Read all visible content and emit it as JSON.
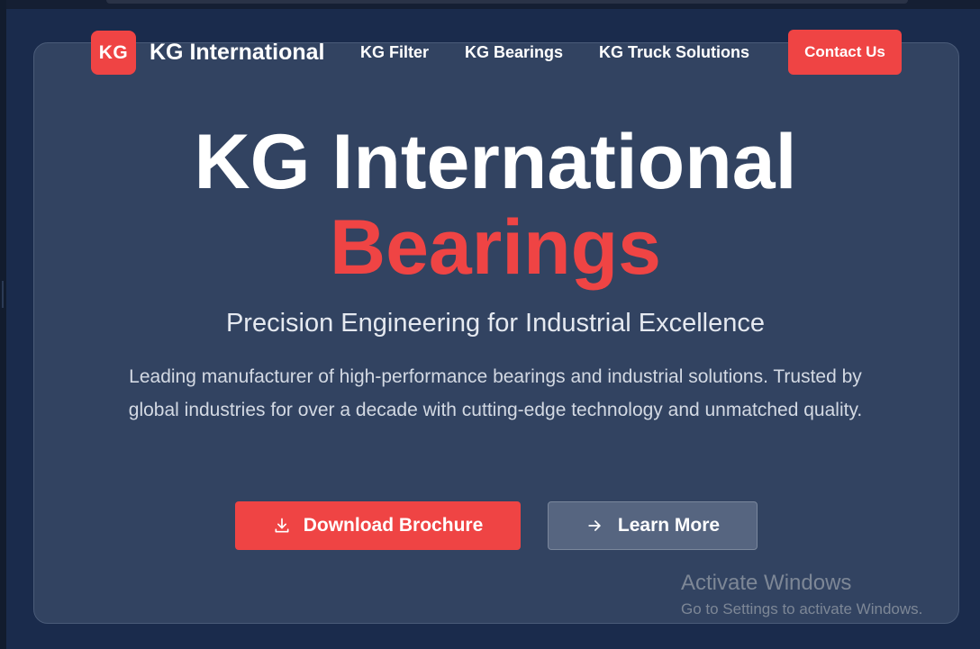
{
  "nav": {
    "logo_badge": "KG",
    "logo_text": "KG International",
    "links": [
      "KG Filter",
      "KG Bearings",
      "KG Truck Solutions"
    ],
    "contact_label": "Contact Us"
  },
  "hero": {
    "title_line1": "KG International",
    "title_line2": "Bearings",
    "subtitle": "Precision Engineering for Industrial Excellence",
    "description": "Leading manufacturer of high-performance bearings and industrial solutions. Trusted by global industries for over a decade with cutting-edge technology and unmatched quality.",
    "primary_button": {
      "label": "Download Brochure",
      "icon": "download-icon"
    },
    "secondary_button": {
      "label": "Learn More",
      "icon": "arrow-right-icon"
    }
  },
  "watermark": {
    "title": "Activate Windows",
    "subtitle": "Go to Settings to activate Windows."
  },
  "colors": {
    "background": "#1a2b4c",
    "card": "#324361",
    "accent": "#ef4444",
    "secondary_button": "#566580"
  }
}
